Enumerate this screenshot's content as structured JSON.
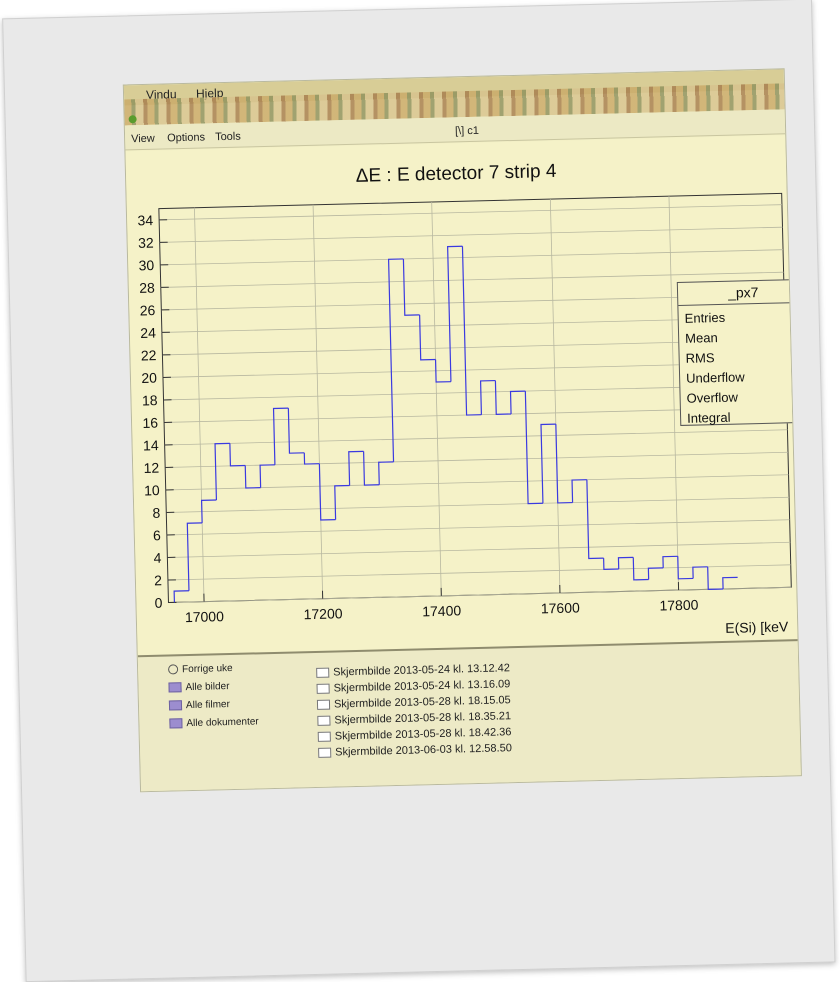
{
  "menu": {
    "items": [
      "Vindu",
      "Hjelp"
    ]
  },
  "toolbar": {
    "view": "View",
    "options": "Options",
    "tools": "Tools",
    "canvas": "[\\] c1"
  },
  "stats": {
    "title": "_px7",
    "rows": [
      "Entries",
      "Mean",
      "RMS",
      "Underflow",
      "Overflow",
      "Integral"
    ]
  },
  "sidebar": {
    "items": [
      "Forrige uke",
      "Alle bilder",
      "Alle filmer",
      "Alle dokumenter"
    ]
  },
  "files": [
    "Skjermbilde 2013-05-24 kl. 13.12.42",
    "Skjermbilde 2013-05-24 kl. 13.16.09",
    "Skjermbilde 2013-05-28 kl. 18.15.05",
    "Skjermbilde 2013-05-28 kl. 18.35.21",
    "Skjermbilde 2013-05-28 kl. 18.42.36",
    "Skjermbilde 2013-06-03 kl. 12.58.50"
  ],
  "colors": {
    "line": "#3a3ae0",
    "background": "#f5f2c8",
    "grid": "#b8b8a0"
  },
  "chart_data": {
    "type": "bar",
    "title": "ΔE : E detector 7 strip 4",
    "xlabel": "E(Si) [keV",
    "ylabel": "",
    "x_ticks": [
      17000,
      17200,
      17400,
      17600,
      17800
    ],
    "y_ticks": [
      0,
      2,
      4,
      6,
      8,
      10,
      12,
      14,
      16,
      18,
      20,
      22,
      24,
      26,
      28,
      30,
      32,
      34
    ],
    "xlim": [
      16940,
      17990
    ],
    "ylim": [
      0,
      35
    ],
    "grid": true,
    "bin_width": 25,
    "bin_edges_start": 16950,
    "values": [
      1,
      7,
      9,
      14,
      12,
      10,
      12,
      17,
      13,
      12,
      7,
      10,
      13,
      10,
      12,
      30,
      25,
      21,
      19,
      31,
      16,
      19,
      16,
      18,
      8,
      15,
      8,
      10,
      3,
      2,
      3,
      1,
      2,
      3,
      1,
      2,
      0,
      1
    ]
  }
}
